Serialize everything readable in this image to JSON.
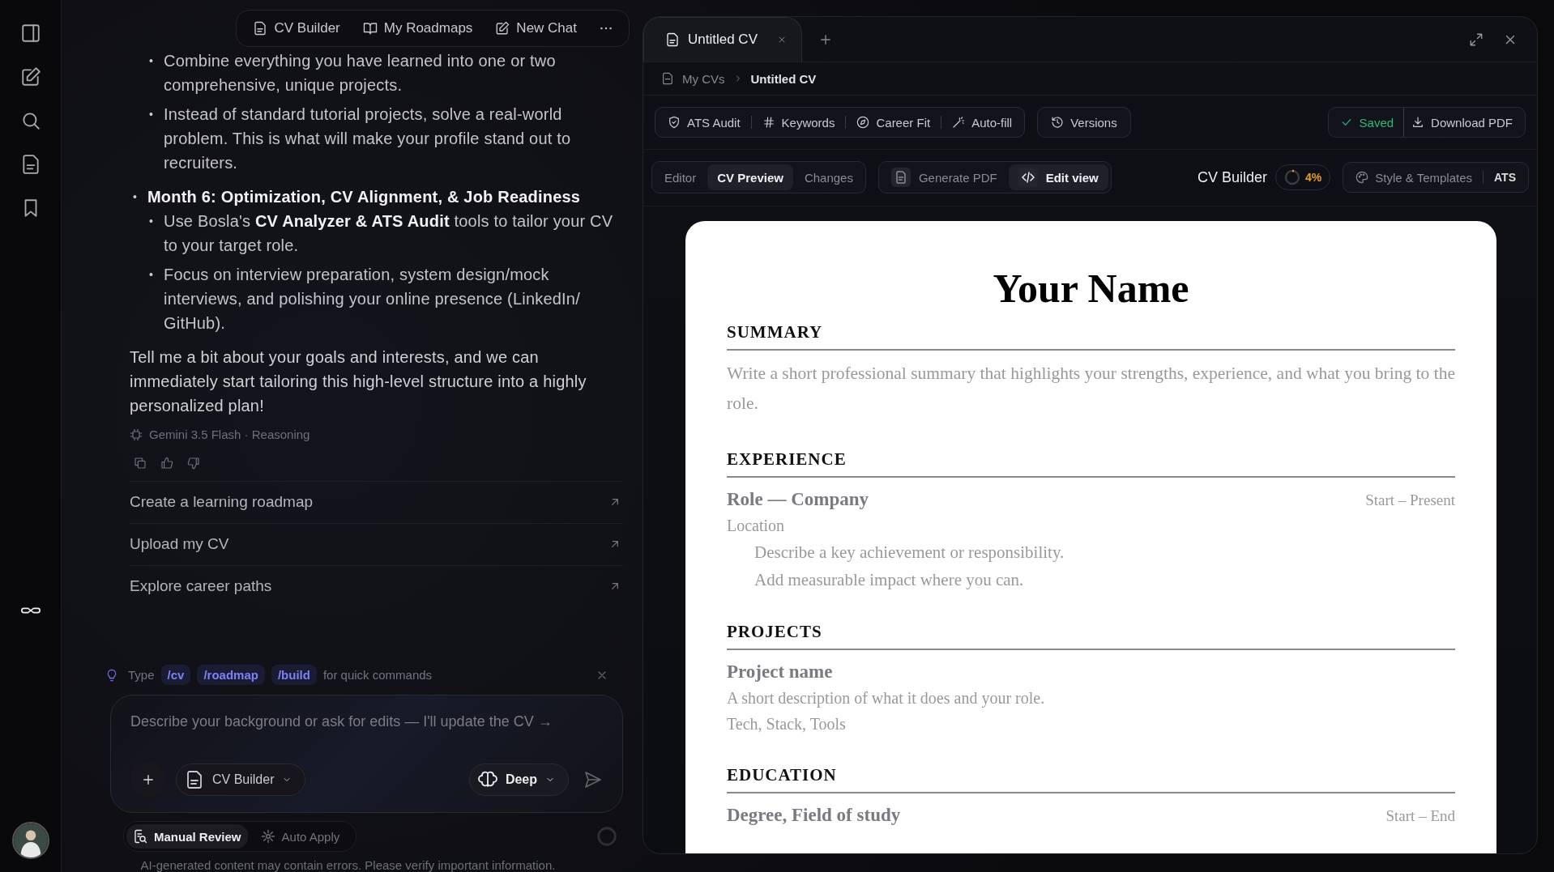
{
  "chat_toolbar": {
    "buttons": [
      {
        "kind": "cv",
        "label": "CV Builder"
      },
      {
        "kind": "roadmap",
        "label": "My Roadmaps"
      },
      {
        "kind": "new",
        "label": "New Chat"
      }
    ]
  },
  "message": {
    "outline": [
      {
        "children": [
          {
            "marker": "•",
            "text": "Combine everything you have learned into one or two comprehensive, unique projects."
          },
          {
            "marker": "•",
            "text": "Instead of standard tutorial projects, solve a real-world problem. This is what will make your profile stand out to recruiters."
          }
        ]
      },
      {
        "marker": "•",
        "heading": "Month 6: Optimization, CV Alignment, & Job Readiness",
        "children": [
          {
            "marker": "•",
            "text": "Use Bosla's **CV Analyzer & ATS Audit** tools to tailor your CV to your target role."
          },
          {
            "marker": "•",
            "text": "Focus on interview preparation, system design/mock interviews, and polishing your online presence (LinkedIn/ GitHub)."
          }
        ]
      }
    ],
    "closing": "Tell me a bit about your goals and interests, and we can immediately start tailoring this high-level structure into a highly personalized plan!",
    "model": "Gemini 3.5 Flash · Reasoning"
  },
  "suggestions": [
    "Create a learning roadmap",
    "Upload my CV",
    "Explore career paths"
  ],
  "hint": {
    "prefix": "Type",
    "commands": [
      "/cv",
      "/roadmap",
      "/build"
    ],
    "suffix": "for quick commands"
  },
  "composer": {
    "placeholder": "Describe your background or ask for edits — I'll update the CV →",
    "tool": "CV Builder",
    "mode": "Deep"
  },
  "review_modes": [
    {
      "kind": "manual",
      "label": "Manual Review",
      "selected": true
    },
    {
      "kind": "auto",
      "label": "Auto Apply",
      "selected": false
    }
  ],
  "disclaimer": "AI-generated content may contain errors. Please verify important information.",
  "editor": {
    "tabs": [
      {
        "label": "Untitled CV",
        "selected": true
      }
    ],
    "breadcrumb": [
      "My CVs",
      "Untitled CV"
    ],
    "actions": [
      {
        "kind": "shield",
        "label": "ATS Audit"
      },
      {
        "kind": "hash",
        "label": "Keywords"
      },
      {
        "kind": "compass",
        "label": "Career Fit"
      },
      {
        "kind": "wand",
        "label": "Auto-fill"
      }
    ],
    "versions": "Versions",
    "save_status": "Saved",
    "download": "Download PDF",
    "views": [
      {
        "label": "Editor",
        "selected": false
      },
      {
        "label": "CV Preview",
        "selected": true
      },
      {
        "label": "Changes",
        "selected": false
      }
    ],
    "pdf_tools": [
      {
        "kind": "doc",
        "label": "Generate PDF",
        "selected": false
      },
      {
        "kind": "code",
        "label": "Edit view",
        "selected": true
      }
    ],
    "builder_label": "CV Builder",
    "progress": {
      "level": 0.04,
      "reading": "4%"
    },
    "style_button": "Style & Templates",
    "ats_label": "ATS"
  },
  "cv": {
    "name": "Your Name",
    "sections": [
      {
        "title": "SUMMARY",
        "text": "Write a short professional summary that highlights your strengths, experience, and what you bring to the role."
      },
      {
        "title": "EXPERIENCE",
        "entries": [
          {
            "title": "Role — Company",
            "dates": "Start – Present",
            "lines": [
              "Location"
            ],
            "bullets": [
              "Describe a key achievement or responsibility.",
              "Add measurable impact where you can."
            ]
          }
        ]
      },
      {
        "title": "PROJECTS",
        "entries": [
          {
            "title": "Project name",
            "lines": [
              "A short description of what it does and your role.",
              "Tech, Stack, Tools"
            ]
          }
        ]
      },
      {
        "title": "EDUCATION",
        "entries": [
          {
            "title": "Degree, Field of study",
            "dates": "Start – End"
          }
        ]
      }
    ]
  }
}
